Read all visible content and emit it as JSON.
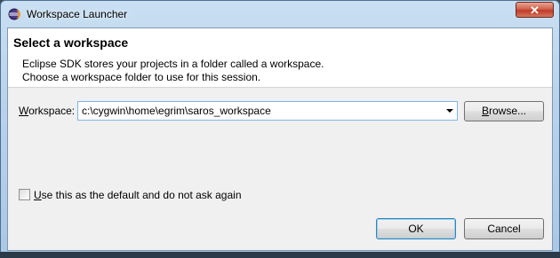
{
  "window": {
    "title": "Workspace Launcher",
    "close_label": "✕"
  },
  "banner": {
    "title": "Select a workspace",
    "line1": "Eclipse SDK stores your projects in a folder called a workspace.",
    "line2": "Choose a workspace folder to use for this session."
  },
  "workspace": {
    "label_mnemonic": "W",
    "label_rest": "orkspace:",
    "value": "c:\\cygwin\\home\\egrim\\saros_workspace"
  },
  "buttons": {
    "browse_mnemonic": "B",
    "browse_rest": "rowse...",
    "ok": "OK",
    "cancel": "Cancel"
  },
  "default_checkbox": {
    "label_mnemonic": "U",
    "label_rest": "se this as the default and do not ask again",
    "checked": false
  }
}
